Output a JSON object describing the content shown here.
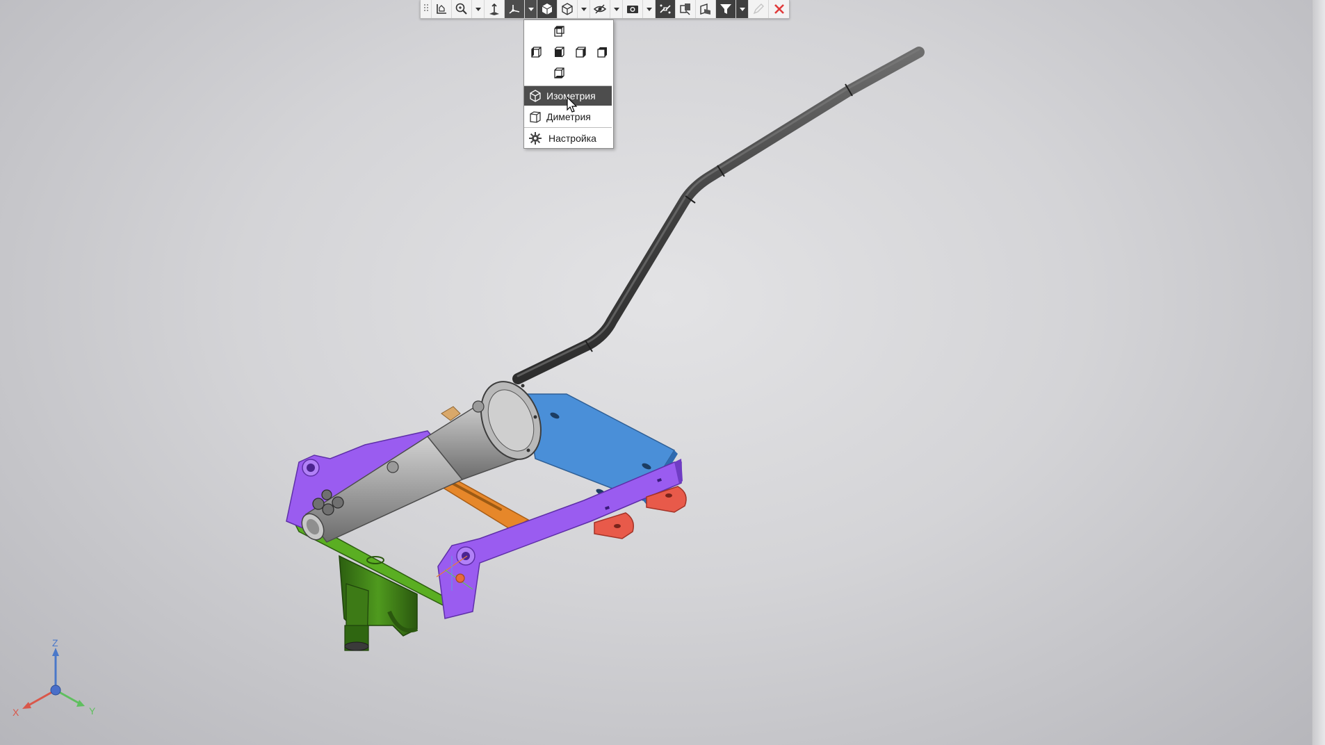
{
  "toolbar": {
    "buttons": [
      {
        "name": "grip",
        "icon": "grip-icon"
      },
      {
        "name": "sketch",
        "icon": "sketch-plane-icon"
      },
      {
        "name": "zoom",
        "icon": "zoom-icon",
        "dropdown": true
      },
      {
        "name": "normal-to",
        "icon": "normal-to-icon"
      },
      {
        "name": "orientation",
        "icon": "orientation-icon",
        "dropdown": true,
        "active": true
      },
      {
        "name": "shaded",
        "icon": "shaded-cube-icon",
        "dark": true
      },
      {
        "name": "display-style",
        "icon": "wireframe-cube-icon",
        "dropdown": true
      },
      {
        "name": "hide",
        "icon": "hide-eye-icon",
        "dropdown": true
      },
      {
        "name": "view-settings",
        "icon": "camera-icon",
        "dropdown": true
      },
      {
        "name": "section",
        "icon": "section-icon",
        "dark": true
      },
      {
        "name": "explode",
        "icon": "explode-icon"
      },
      {
        "name": "layers",
        "icon": "layers-icon"
      },
      {
        "name": "filter",
        "icon": "filter-icon",
        "dropdown": true,
        "dark": true
      },
      {
        "name": "edit",
        "icon": "pencil-icon",
        "disabled": true
      },
      {
        "name": "close",
        "icon": "close-icon",
        "color": "#e03a3a"
      }
    ]
  },
  "orientation_menu": {
    "view_cubes": [
      "top-view-icon",
      "left-view-icon",
      "front-view-icon",
      "right-view-icon",
      "back-view-icon",
      "bottom-view-icon"
    ],
    "items": [
      {
        "label": "Изометрия",
        "icon": "isometric-cube-icon",
        "active": true
      },
      {
        "label": "Диметрия",
        "icon": "dimetric-cube-icon",
        "active": false
      },
      {
        "label": "Настройка",
        "icon": "gear-icon",
        "active": false
      }
    ]
  },
  "triad": {
    "x_label": "X",
    "y_label": "Y",
    "z_label": "Z"
  },
  "colors": {
    "purple": "#9a5cf0",
    "blue": "#4a8fd8",
    "orange": "#e6872a",
    "green": "#4f9a1e",
    "red": "#e85a4a",
    "rod": "#4a4a4a",
    "cylinder": "#a9a9a9",
    "accent_active": "#4d4d4d"
  }
}
